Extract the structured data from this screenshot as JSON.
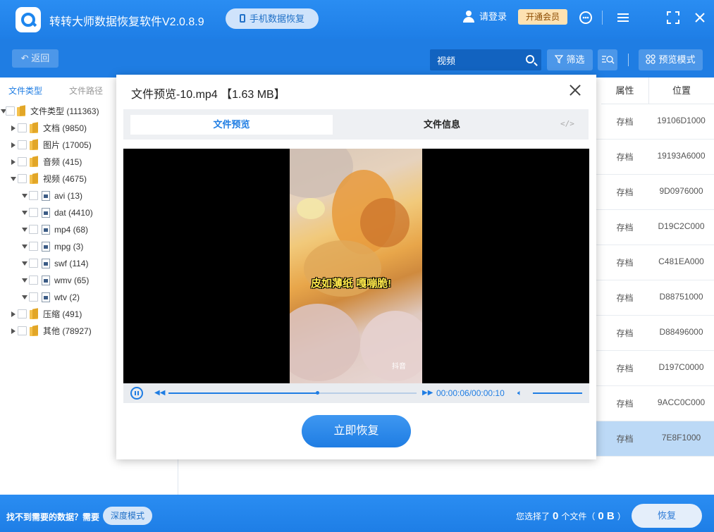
{
  "app": {
    "title": "转转大师数据恢复软件V2.0.8.9",
    "mobile_recovery": "手机数据恢复",
    "login": "请登录",
    "vip": "开通会员"
  },
  "toolbar": {
    "back": "返回",
    "search_value": "视频",
    "filter": "筛选",
    "preview_mode": "预览模式"
  },
  "left_tabs": {
    "file_type": "文件类型",
    "file_path": "文件路径"
  },
  "tree": [
    {
      "label": "文件类型 (111363)"
    },
    {
      "label": "文档 (9850)"
    },
    {
      "label": "图片 (17005)"
    },
    {
      "label": "音频 (415)"
    },
    {
      "label": "视频 (4675)"
    },
    {
      "label": "avi (13)"
    },
    {
      "label": "dat (4410)"
    },
    {
      "label": "mp4 (68)"
    },
    {
      "label": "mpg (3)"
    },
    {
      "label": "swf (114)"
    },
    {
      "label": "wmv (65)"
    },
    {
      "label": "wtv (2)"
    },
    {
      "label": "压缩 (491)"
    },
    {
      "label": "其他 (78927)"
    }
  ],
  "table": {
    "headers": {
      "attr": "属性",
      "pos": "位置"
    },
    "rows": [
      {
        "attr": "存档",
        "pos": "19106D1000"
      },
      {
        "attr": "存档",
        "pos": "19193A6000"
      },
      {
        "attr": "存档",
        "pos": "9D0976000"
      },
      {
        "attr": "存档",
        "pos": "D19C2C000"
      },
      {
        "attr": "存档",
        "pos": "C481EA000"
      },
      {
        "attr": "存档",
        "pos": "D88751000"
      },
      {
        "attr": "存档",
        "pos": "D88496000"
      },
      {
        "attr": "存档",
        "pos": "D197C0000"
      },
      {
        "attr": "存档",
        "pos": "9ACC0C000"
      },
      {
        "attr": "存档",
        "pos": "7E8F1000"
      }
    ]
  },
  "modal": {
    "title": "文件预览-10.mp4 【1.63 MB】",
    "tab_preview": "文件预览",
    "tab_info": "文件信息",
    "code_symbol": "</>",
    "caption": "皮如薄纸 嘎嘣脆!",
    "watermark": "抖音",
    "time": "00:00:06/00:00:10",
    "progress": 0.6,
    "restore": "立即恢复"
  },
  "bottom": {
    "not_found": "找不到需要的数据？需要",
    "deep_mode": "深度模式",
    "selected_prefix": "您选择了",
    "selected_count": "0",
    "selected_unit": "个文件（",
    "selected_size": "0 B",
    "selected_suffix": "）",
    "recover": "恢复"
  }
}
